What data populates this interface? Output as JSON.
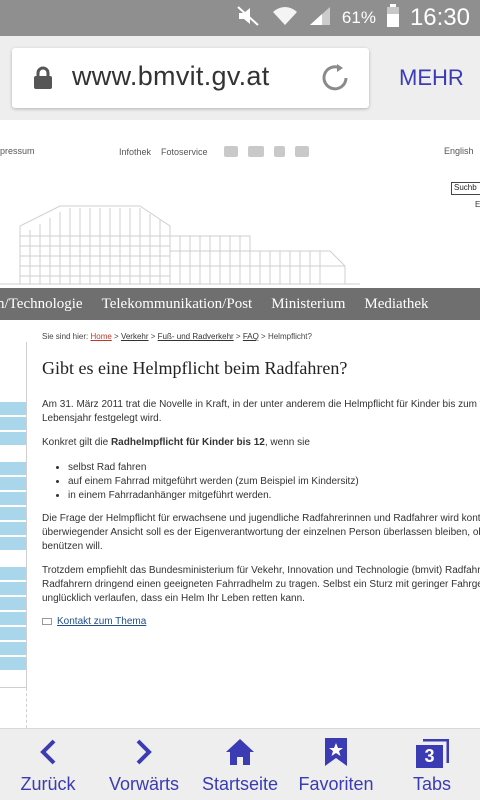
{
  "status_bar": {
    "battery_percent": "61%",
    "time": "16:30"
  },
  "browser": {
    "url": "www.bmvit.gv.at",
    "menu_label": "MEHR"
  },
  "site": {
    "top_left_link": "pressum",
    "top_links": [
      "Infothek",
      "Fotoservice"
    ],
    "language_link": "English",
    "search_placeholder": "Suchb",
    "search_fragment": "E",
    "nav_items": [
      "n/Technologie",
      "Telekommunikation/Post",
      "Ministerium",
      "Mediathek"
    ]
  },
  "article": {
    "breadcrumb_prefix": "Sie sind hier:",
    "breadcrumb": [
      "Home",
      "Verkehr",
      "Fuß- und Radverkehr",
      "FAQ",
      "Helmpflicht?"
    ],
    "title": "Gibt es eine Helmpflicht beim Radfahren?",
    "p1_line1": "Am 31. März 2011 trat die Novelle in Kraft, in der unter anderem die Helmpflicht für Kinder bis zum vollen",
    "p1_line2": "Lebensjahr festgelegt wird.",
    "p2_prefix": "Konkret gilt die ",
    "p2_bold": "Radhelmpflicht für Kinder bis 12",
    "p2_suffix": ", wenn sie",
    "bullets": [
      "selbst Rad fahren",
      "auf einem Fahrrad mitgeführt werden (zum Beispiel im Kindersitz)",
      "in einem Fahrradanhänger mitgeführt werden."
    ],
    "p3_line1": "Die Frage der Helmpflicht für erwachsene und jugendliche Radfahrerinnen und Radfahrer wird kontrovers",
    "p3_line2": "überwiegender Ansicht soll es der Eigenverantwortung der einzelnen Person überlassen bleiben, ob sie Fa",
    "p3_line3": "benützen will.",
    "p4_line1": "Trotzdem empfiehlt das Bundesministerium für Vekehr, Innovation und Technologie (bmvit) Radfahrerinn",
    "p4_line2": "Radfahrern dringend einen geeigneten Fahrradhelm zu tragen. Selbst ein Sturz mit geringer Fahrgeschwin",
    "p4_line3": "unglücklich verlaufen, dass ein Helm Ihr Leben retten kann.",
    "contact_link": "Kontakt zum Thema"
  },
  "bottom_bar": {
    "back": "Zurück",
    "forward": "Vorwärts",
    "home": "Startseite",
    "favorites": "Favoriten",
    "tabs": "Tabs",
    "tab_count": "3"
  },
  "colors": {
    "accent": "#3b3bb3",
    "nav_bg": "#6f6f6f",
    "sidebar_stripe": "#a9d6ea"
  }
}
